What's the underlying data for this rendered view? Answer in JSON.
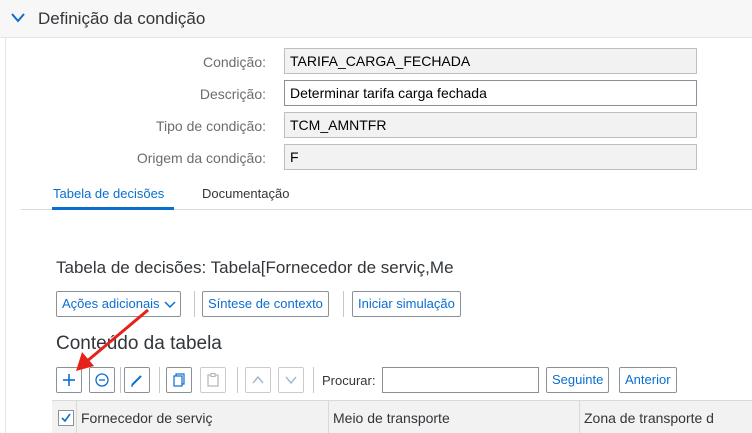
{
  "section": {
    "title": "Definição da condição",
    "icon": "chevron-down-icon"
  },
  "form": {
    "condicao": {
      "label": "Condição:",
      "value": "TARIFA_CARGA_FECHADA"
    },
    "descricao": {
      "label": "Descrição:",
      "value": "Determinar tarifa carga fechada"
    },
    "tipo": {
      "label": "Tipo de condição:",
      "value": "TCM_AMNTFR"
    },
    "origem": {
      "label": "Origem da condição:",
      "value": "F"
    }
  },
  "tabs": [
    {
      "label": "Tabela de decisões",
      "active": true
    },
    {
      "label": "Documentação",
      "active": false
    }
  ],
  "decision_table": {
    "title": "Tabela de decisões: Tabela[Fornecedor de serviç,Me",
    "toolbar": {
      "acoes_label": "Ações adicionais",
      "sintese_label": "Síntese de contexto",
      "simulacao_label": "Iniciar simulação"
    }
  },
  "content": {
    "title": "Conteúdo da tabela",
    "toolbar": {
      "search_label": "Procurar:",
      "search_value": "",
      "next_label": "Seguinte",
      "prev_label": "Anterior",
      "icons": [
        "add-icon",
        "remove-icon",
        "edit-icon",
        "copy-icon",
        "paste-icon",
        "move-up-icon",
        "move-down-icon"
      ]
    },
    "columns": [
      "Fornecedor de serviç",
      "Meio de transporte",
      "Zona de transporte d"
    ]
  },
  "colors": {
    "accent": "#0a6ed1",
    "annotation_arrow": "#e5231b"
  }
}
